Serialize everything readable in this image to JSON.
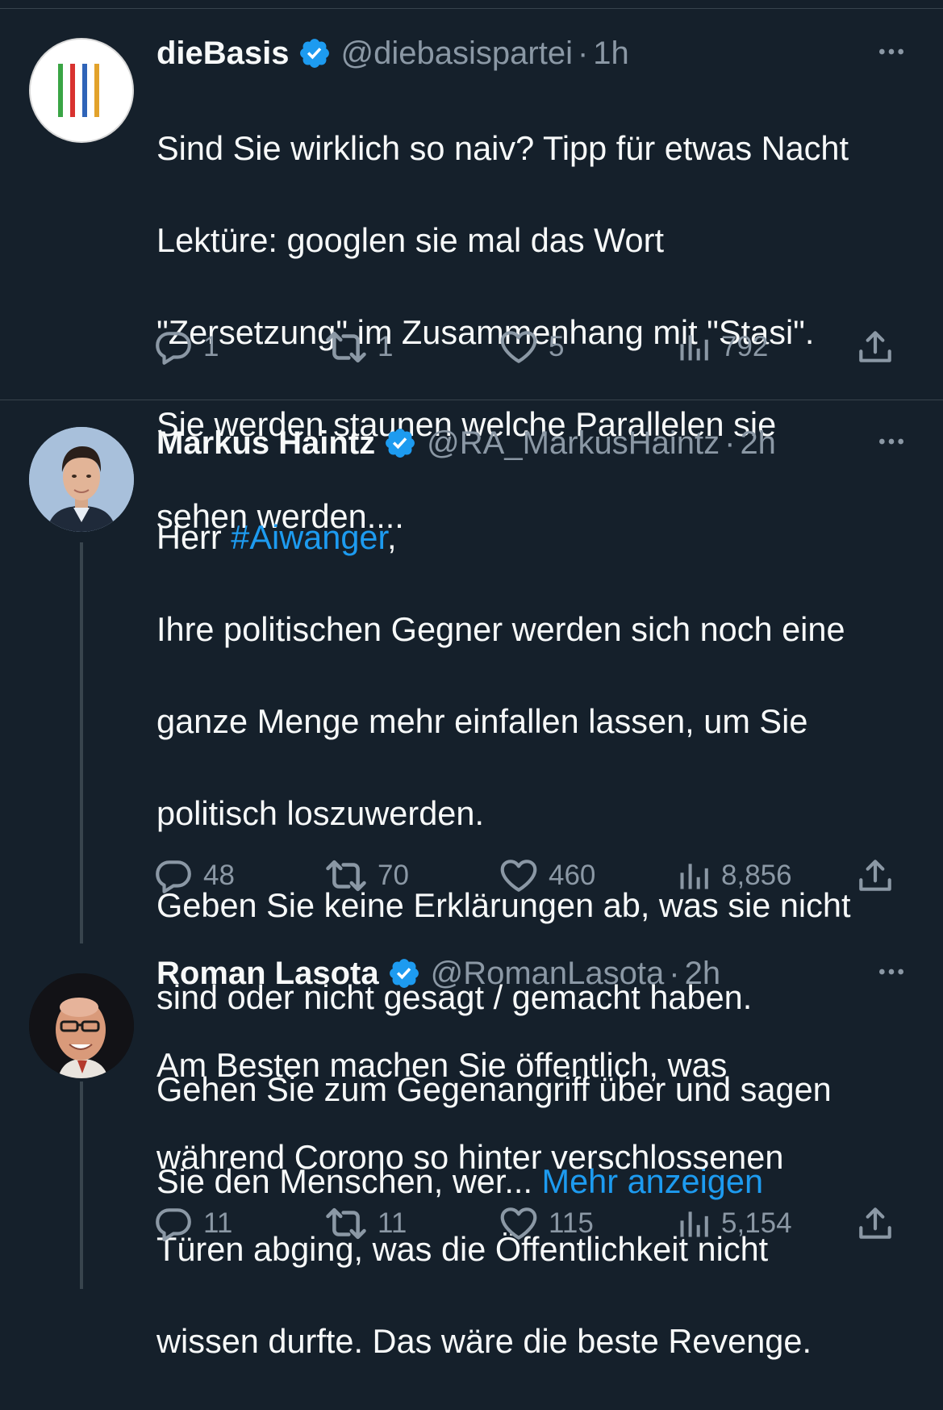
{
  "colors": {
    "background": "#15202b",
    "text": "#f7f9f9",
    "muted": "#8b98a5",
    "link": "#1d9bf0",
    "divider": "#38444d"
  },
  "tweets": [
    {
      "name": "dieBasis",
      "handle": "@diebasispartei",
      "dot": "·",
      "time": "1h",
      "lines": [
        "Sind Sie wirklich so naiv? Tipp für etwas Nacht",
        "Lektüre: googlen sie mal das Wort",
        "\"Zersetzung\" im Zusammenhang mit \"Stasi\".",
        "Sie werden staunen welche Parallelen sie",
        "sehen werden...."
      ],
      "replies": "1",
      "retweets": "1",
      "likes": "5",
      "views": "792"
    },
    {
      "name": "Markus Haintz",
      "handle": "@RA_MarkusHaintz",
      "dot": "·",
      "time": "2h",
      "line1_prefix": "Herr ",
      "hashtag": "#Aiwanger",
      "line1_suffix": ",",
      "lines": [
        "Ihre politischen Gegner werden sich noch eine",
        "ganze Menge mehr einfallen lassen, um Sie",
        "politisch loszuwerden.",
        "Geben Sie keine Erklärungen ab, was sie nicht",
        "sind oder nicht gesagt / gemacht haben.",
        "Gehen Sie zum Gegenangriff über und sagen"
      ],
      "last_line": "Sie den Menschen, wer... ",
      "show_more": "Mehr anzeigen",
      "replies": "48",
      "retweets": "70",
      "likes": "460",
      "views": "8,856"
    },
    {
      "name": "Roman Lasota",
      "handle": "@RomanLasota",
      "dot": "·",
      "time": "2h",
      "lines": [
        "Am Besten machen Sie öffentlich, was",
        "während Corono so hinter verschlossenen",
        "Türen abging, was die Öffentlichkeit nicht",
        "wissen durfte. Das wäre die beste Revenge."
      ],
      "replies": "11",
      "retweets": "11",
      "likes": "115",
      "views": "5,154"
    }
  ],
  "icons": {
    "verified": "verified-badge-icon",
    "more": "more-dots-icon",
    "reply": "reply-bubble-icon",
    "retweet": "retweet-arrows-icon",
    "like": "heart-icon",
    "views": "views-bars-icon",
    "share": "share-upload-icon"
  }
}
